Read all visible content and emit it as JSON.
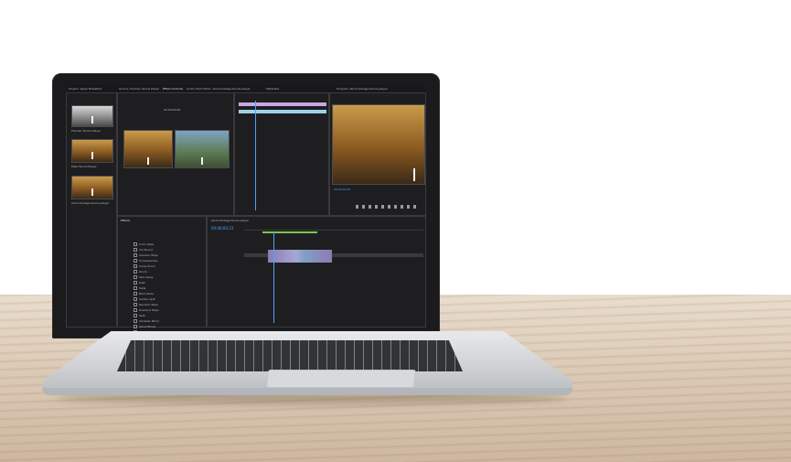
{
  "scene": {
    "description_colors": {
      "wall": "#ffffff",
      "table": "#dccab6",
      "laptop_bezel": "#1b1b1d"
    }
  },
  "app": {
    "project_tab": "Project: Apple Breakfast",
    "source_tab": "Source: Premier Tennis Player",
    "effect_controls_tab": "Effect Controls",
    "audio_tab": "Audio Track Mixer: stock-footage-tennis-player",
    "metadata_tab": "Metadata",
    "program_tab": "Program: stock-footage-tennis-player",
    "timeline_tab": "stock-footage-tennis-player",
    "left_bin": [
      {
        "label": "Premier Tennis Player"
      },
      {
        "label": "Male Tennis Player"
      },
      {
        "label": "stock-footage-tennis-player"
      }
    ],
    "effects_panel_title": "Effects",
    "effects_list": [
      "Color Wipe",
      "Iris Round",
      "Checker Wipe",
      "Crossdissolve",
      "Cross Zoom",
      "Zoom",
      "Spin Away",
      "Push",
      "Slide",
      "Band Slide",
      "Center Split",
      "Random Wipe",
      "Gradient Wipe",
      "Split",
      "Venetian Blind",
      "Spiral Boxes",
      "Iris Box",
      "Clock"
    ],
    "source_timecode": "00;00;00;00",
    "timeline_timecode": "00;00;00;23",
    "program_timecode": "00;00;00;23"
  }
}
